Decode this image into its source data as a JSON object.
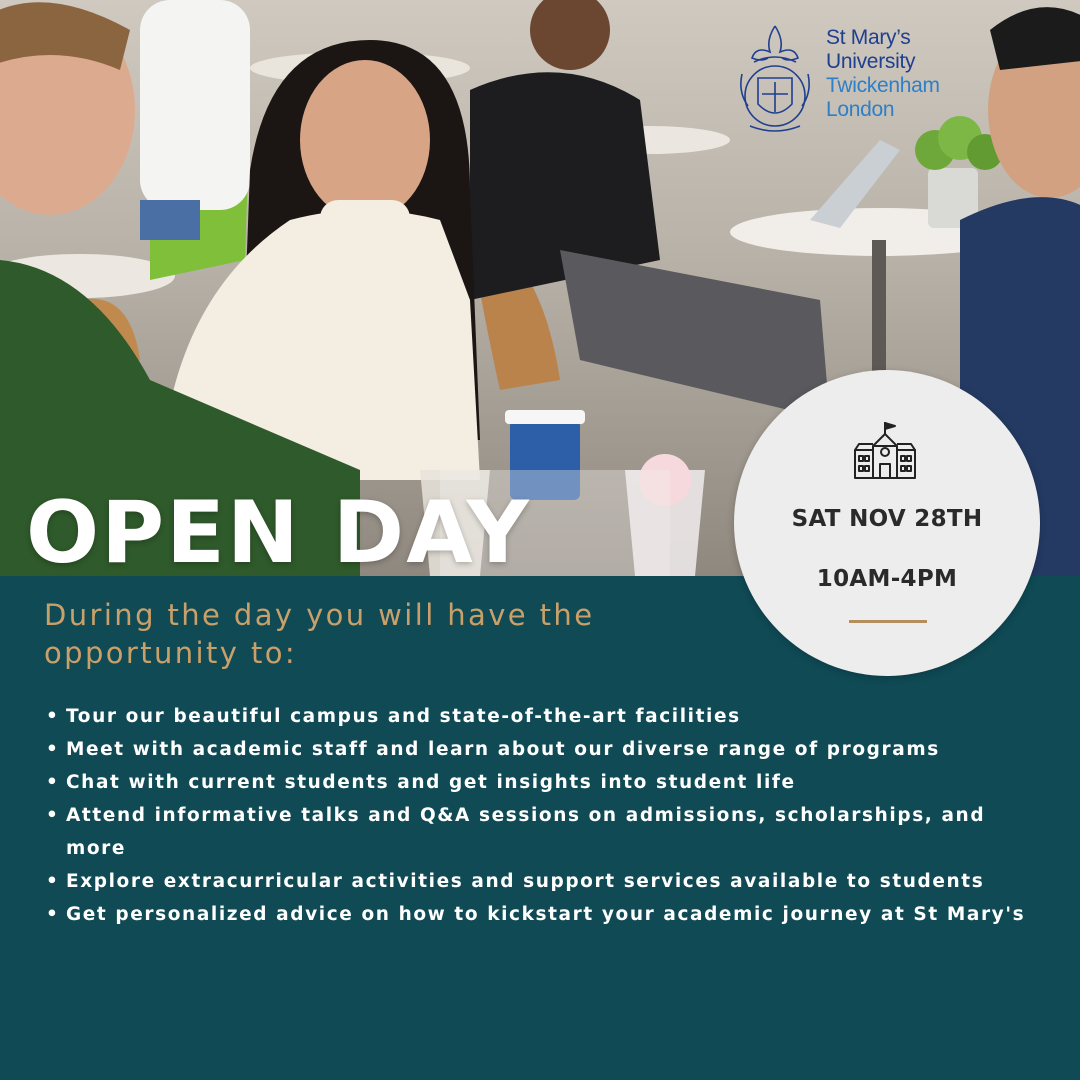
{
  "logo": {
    "line1": "St Mary’s",
    "line2": "University",
    "line3": "Twickenham",
    "line4": "London"
  },
  "headline": "OPEN DAY",
  "event": {
    "icon": "school-building-icon",
    "date": "SAT NOV 28TH",
    "time": "10AM-4PM"
  },
  "intro": "During the day you will have the opportunity to:",
  "bullet": "•",
  "activities": [
    "Tour our beautiful campus and state-of-the-art facilities",
    "Meet with academic staff and learn about our diverse range of programs",
    "Chat with current students and get insights into student life",
    "Attend informative talks and Q&A sessions on admissions, scholarships, and more",
    "Explore extracurricular activities and support services available to students",
    "Get personalized advice on how to kickstart your academic journey at St Mary's"
  ],
  "colors": {
    "panel": "#0f4a55",
    "gold": "#c9a06a",
    "rule": "#b48e5c",
    "circle": "#ededee",
    "logo_dark": "#1f3f8f",
    "logo_light": "#2f7fc6"
  }
}
